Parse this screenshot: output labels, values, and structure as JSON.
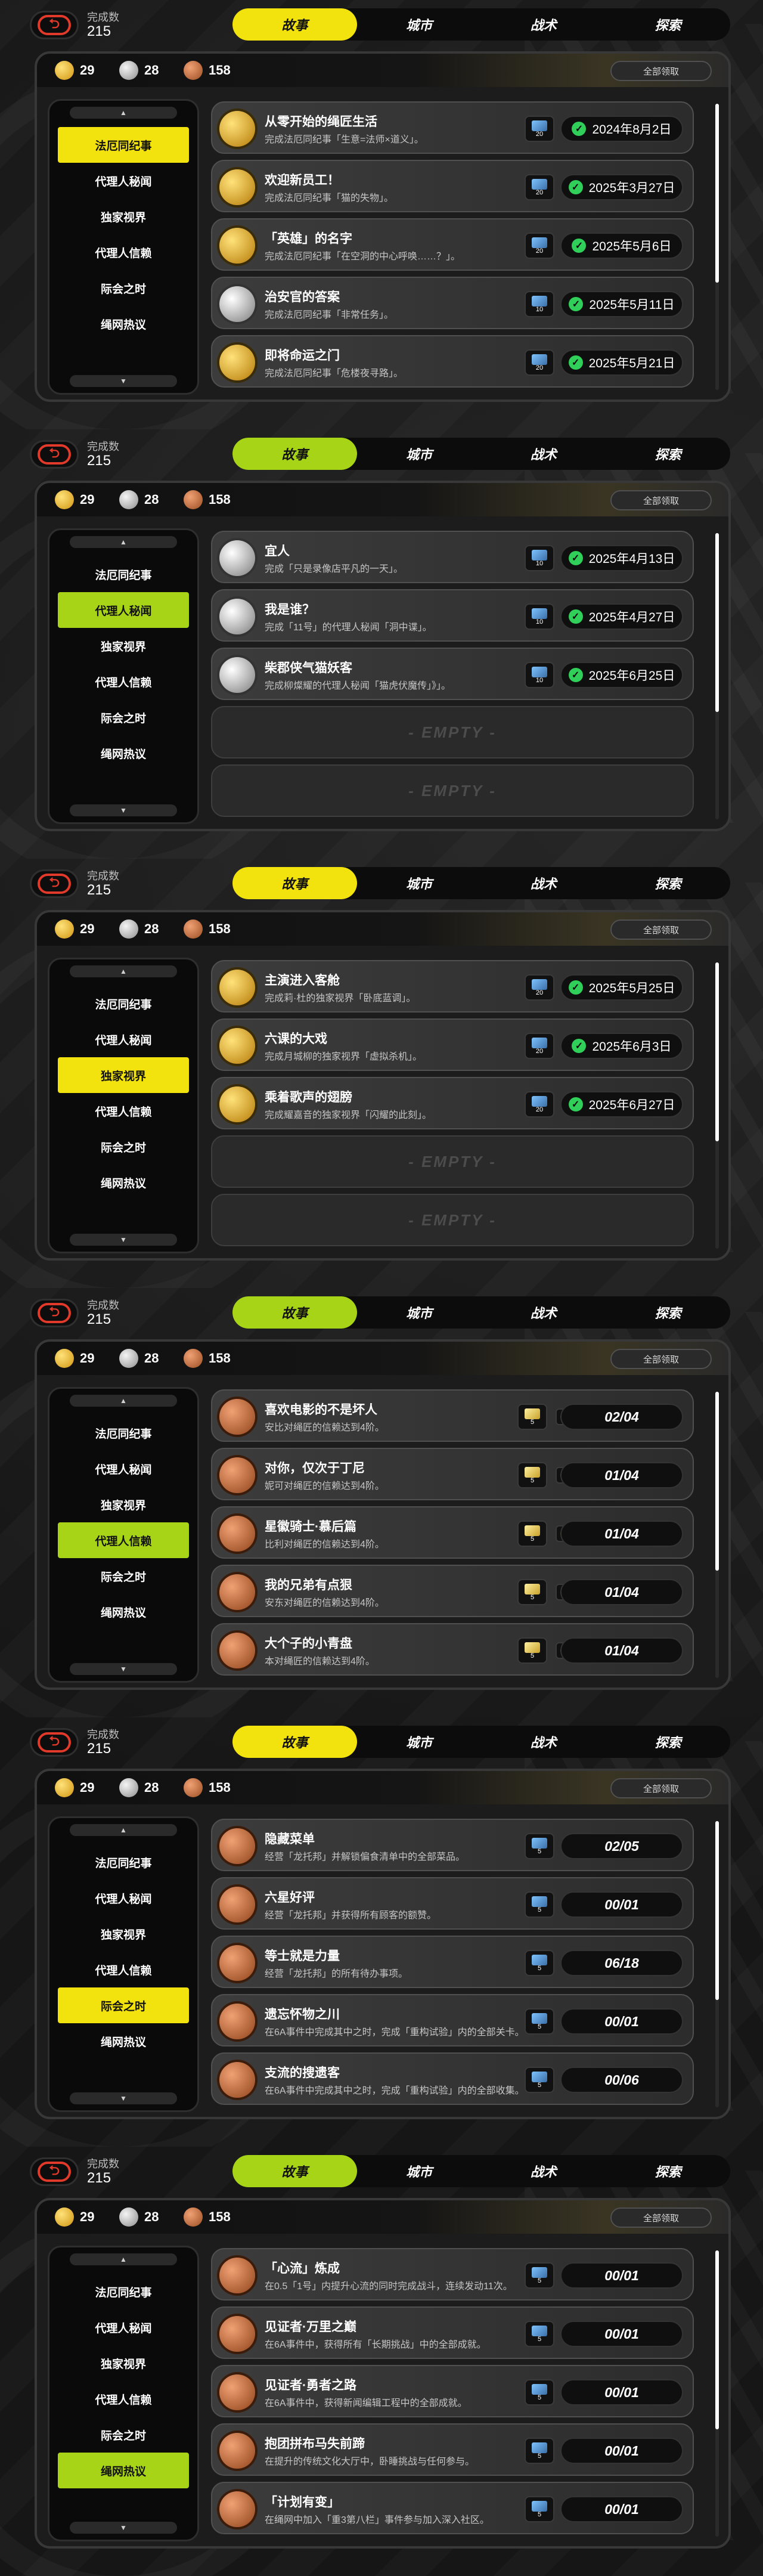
{
  "completion_label": "完成数",
  "completion_value": "215",
  "back_glyph": "⮌",
  "tabs": [
    "故事",
    "城市",
    "战术",
    "探索"
  ],
  "currency": [
    {
      "value": "29",
      "color": "gold"
    },
    {
      "value": "28",
      "color": "silver"
    },
    {
      "value": "158",
      "color": "bronze"
    }
  ],
  "claim_all": "全部领取",
  "scroll_up": "▲",
  "scroll_down": "▼",
  "empty_label": "- EMPTY -",
  "sidebar_categories": [
    "法厄同纪事",
    "代理人秘闻",
    "独家视界",
    "代理人信赖",
    "际会之时",
    "绳网热议"
  ],
  "accent_colors": {
    "yellow": "#f2e20d",
    "green": "#a8d418",
    "check": "#2fcf5a"
  },
  "sections": [
    {
      "tab_active": 0,
      "tab_color": "yellow",
      "sidebar_active": 0,
      "sidebar_color": "yellow",
      "cards": [
        {
          "medal": "gold",
          "title": "从零开始的绳匠生活",
          "desc": "完成法厄同纪事「生意=法师×道义」。",
          "reward": "20",
          "date": "2024年8月2日"
        },
        {
          "medal": "gold",
          "title": "欢迎新员工！",
          "desc": "完成法厄同纪事「猫的失物」。",
          "reward": "20",
          "date": "2025年3月27日"
        },
        {
          "medal": "gold",
          "title": "「英雄」的名字",
          "desc": "完成法厄同纪事「在空洞的中心呼唤……？」。",
          "reward": "20",
          "date": "2025年5月6日"
        },
        {
          "medal": "silver",
          "title": "治安官的答案",
          "desc": "完成法厄同纪事「非常任务」。",
          "reward": "10",
          "date": "2025年5月11日"
        },
        {
          "medal": "gold",
          "title": "即将命运之门",
          "desc": "完成法厄同纪事「危楼夜寻路」。",
          "reward": "20",
          "date": "2025年5月21日"
        }
      ]
    },
    {
      "tab_active": 0,
      "tab_color": "green",
      "sidebar_active": 1,
      "sidebar_color": "green",
      "cards": [
        {
          "medal": "silver",
          "title": "宜人",
          "desc": "完成「只是录像店平凡的一天」。",
          "reward": "10",
          "date": "2025年4月13日"
        },
        {
          "medal": "silver",
          "title": "我是谁？",
          "desc": "完成「11号」的代理人秘闻「洞中谍」。",
          "reward": "10",
          "date": "2025年4月27日"
        },
        {
          "medal": "silver",
          "title": "柴郡侠气猫妖客",
          "desc": "完成柳燦耀的代理人秘闻「猫虎伏魔传」》」。",
          "reward": "10",
          "date": "2025年6月25日"
        },
        {
          "empty": true
        },
        {
          "empty": true
        }
      ]
    },
    {
      "tab_active": 0,
      "tab_color": "yellow",
      "sidebar_active": 2,
      "sidebar_color": "yellow",
      "cards": [
        {
          "medal": "gold",
          "title": "主演进入客舱",
          "desc": "完成莉·杜的独家视界「卧底蓝调」。",
          "reward": "20",
          "date": "2025年5月25日"
        },
        {
          "medal": "gold",
          "title": "六课的大戏",
          "desc": "完成月城柳的独家视界「虚拟杀机」。",
          "reward": "20",
          "date": "2025年6月3日"
        },
        {
          "medal": "gold",
          "title": "乘着歌声的翅膀",
          "desc": "完成耀嘉音的独家视界「闪耀的此刻」。",
          "reward": "20",
          "date": "2025年6月27日"
        },
        {
          "empty": true
        },
        {
          "empty": true
        }
      ]
    },
    {
      "tab_active": 0,
      "tab_color": "green",
      "sidebar_active": 3,
      "sidebar_color": "green",
      "cards": [
        {
          "medal": "bronze",
          "title": "喜欢电影的不是坏人",
          "desc": "安比对绳匠的信赖达到4阶。",
          "reward": "5",
          "mat": true,
          "progress": "02/04"
        },
        {
          "medal": "bronze",
          "title": "对你，仅次于丁尼",
          "desc": "妮可对绳匠的信赖达到4阶。",
          "reward": "5",
          "mat": true,
          "progress": "01/04"
        },
        {
          "medal": "bronze",
          "title": "星徽骑士·慕后篇",
          "desc": "比利对绳匠的信赖达到4阶。",
          "reward": "5",
          "mat": true,
          "progress": "01/04"
        },
        {
          "medal": "bronze",
          "title": "我的兄弟有点狠",
          "desc": "安东对绳匠的信赖达到4阶。",
          "reward": "5",
          "mat": true,
          "progress": "01/04"
        },
        {
          "medal": "bronze",
          "title": "大个子的小青盘",
          "desc": "本对绳匠的信赖达到4阶。",
          "reward": "5",
          "mat": true,
          "progress": "01/04"
        }
      ]
    },
    {
      "tab_active": 0,
      "tab_color": "yellow",
      "sidebar_active": 4,
      "sidebar_color": "yellow",
      "cards": [
        {
          "medal": "bronze",
          "title": "隐藏菜单",
          "desc": "经营「龙托邦」并解锁偏食清单中的全部菜品。",
          "reward": "5",
          "progress": "02/05"
        },
        {
          "medal": "bronze",
          "title": "六星好评",
          "desc": "经营「龙托邦」并获得所有顾客的额赞。",
          "reward": "5",
          "progress": "00/01"
        },
        {
          "medal": "bronze",
          "title": "等士就是力量",
          "desc": "经营「龙托邦」的所有待办事项。",
          "reward": "5",
          "progress": "06/18"
        },
        {
          "medal": "bronze",
          "title": "遗忘怀物之川",
          "desc": "在6A事件中完成其中之时，完成「重构试验」内的全部关卡。",
          "reward": "5",
          "progress": "00/01"
        },
        {
          "medal": "bronze",
          "title": "支流的搜遗客",
          "desc": "在6A事件中完成其中之时，完成「重构试验」内的全部收集。",
          "reward": "5",
          "progress": "00/06"
        }
      ]
    },
    {
      "tab_active": 0,
      "tab_color": "green",
      "sidebar_active": 5,
      "sidebar_color": "green",
      "cards": [
        {
          "medal": "bronze",
          "title": "「心流」炼成",
          "desc": "在0.5「1号」内提升心流的同时完成战斗，连续发动11次。",
          "reward": "5",
          "progress": "00/01"
        },
        {
          "medal": "bronze",
          "title": "见证者·万里之巅",
          "desc": "在6A事件中，获得所有「长期挑战」中的全部成就。",
          "reward": "5",
          "progress": "00/01"
        },
        {
          "medal": "bronze",
          "title": "见证者·勇者之路",
          "desc": "在6A事件中，获得新闻编辑工程中的全部成就。",
          "reward": "5",
          "progress": "00/01"
        },
        {
          "medal": "bronze",
          "title": "抱团拼布马失前蹄",
          "desc": "在提升的传统文化大厅中，卧睡挑战与任何参与。",
          "reward": "5",
          "progress": "00/01"
        },
        {
          "medal": "bronze",
          "title": "「计划有变」",
          "desc": "在绳网中加入「重3第八栏」事件参与加入深入社区。",
          "reward": "5",
          "progress": "00/01"
        }
      ]
    }
  ]
}
